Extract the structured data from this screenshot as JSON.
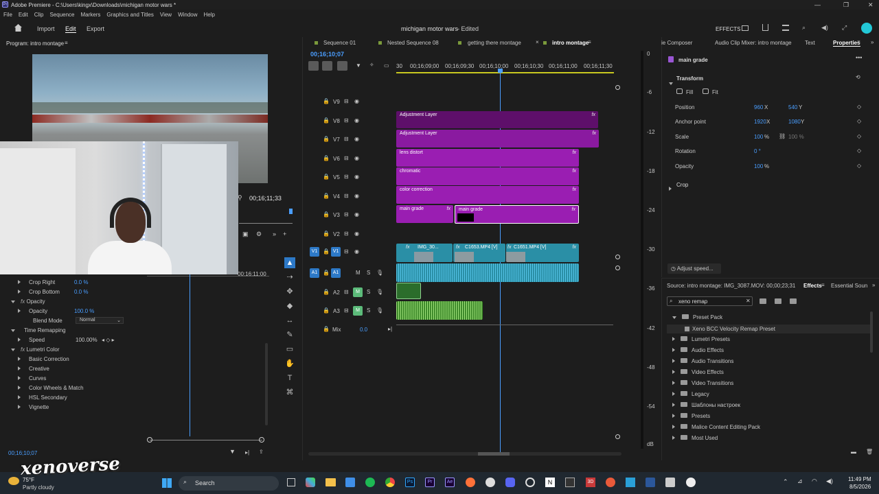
{
  "window": {
    "title": "Adobe Premiere - C:\\Users\\kingx\\Downloads\\michigan motor wars *",
    "minimize": "—",
    "maximize": "❐",
    "close": "✕"
  },
  "menu": [
    "File",
    "Edit",
    "Clip",
    "Sequence",
    "Markers",
    "Graphics and Titles",
    "View",
    "Window",
    "Help"
  ],
  "header": {
    "import": "Import",
    "edit": "Edit",
    "export": "Export",
    "project": "michigan motor wars",
    "status": "- Edited",
    "effects": "EFFECTS"
  },
  "program": {
    "title": "Program: intro montage",
    "timecode": "00;16;11;33",
    "ruler_time": "00;16;11;00"
  },
  "effect_controls": {
    "rows": [
      {
        "label": "Crop Right",
        "value": "0.0 %"
      },
      {
        "label": "Crop Bottom",
        "value": "0.0 %"
      },
      {
        "label": "Opacity",
        "value": ""
      },
      {
        "label": "Opacity",
        "value": "100.0 %"
      },
      {
        "label": "Blend Mode",
        "value": "Normal"
      },
      {
        "label": "Time Remapping",
        "value": ""
      },
      {
        "label": "Speed",
        "value": "100.00%"
      },
      {
        "label": "Lumetri Color",
        "value": ""
      },
      {
        "label": "Basic Correction",
        "value": ""
      },
      {
        "label": "Creative",
        "value": ""
      },
      {
        "label": "Curves",
        "value": ""
      },
      {
        "label": "Color Wheels & Match",
        "value": ""
      },
      {
        "label": "HSL Secondary",
        "value": ""
      },
      {
        "label": "Vignette",
        "value": ""
      }
    ],
    "timecode": "00;16;10;07"
  },
  "timeline": {
    "tabs": [
      "Sequence 01",
      "Nested Sequence 08",
      "getting there montage",
      "intro montage"
    ],
    "timecode": "00;16;10;07",
    "ruler": [
      "30",
      "00;16;09;00",
      "00;16;09;30",
      "00;16;10;00",
      "00;16;10;30",
      "00;16;11;00",
      "00;16;11;30"
    ],
    "video_tracks": [
      "V9",
      "V8",
      "V7",
      "V6",
      "V5",
      "V4",
      "V3",
      "V2",
      "V1"
    ],
    "audio_tracks": [
      "A1",
      "A2",
      "A3"
    ],
    "mix_label": "Mix",
    "mix_value": "0.0",
    "clips": {
      "adj1": "Adjustment Layer",
      "adj2": "Adjustment Layer",
      "lens": "lens distort",
      "chrom": "chromatic",
      "cc": "color correction",
      "mg1": "main grade",
      "mg2": "main grade",
      "img": "IMG_30...",
      "c1": "C1653.MP4 [V]",
      "c2": "C1651.MP4 [V]"
    },
    "meter_labels": [
      "0",
      "-6",
      "-12",
      "-18",
      "-24",
      "-30",
      "-36",
      "-42",
      "-48",
      "-54",
      "dB"
    ]
  },
  "properties": {
    "tabs": [
      "ie Composer",
      "Audio Clip Mixer: intro montage",
      "Text",
      "Properties"
    ],
    "clip_name": "main grade",
    "section": "Transform",
    "fill": "Fill",
    "fit": "Fit",
    "position": {
      "label": "Position",
      "x": "960",
      "y": "540"
    },
    "anchor": {
      "label": "Anchor point",
      "x": "1920",
      "y": "1080"
    },
    "scale": {
      "label": "Scale",
      "v": "100",
      "v2": "100 %"
    },
    "rotation": {
      "label": "Rotation",
      "v": "0 °"
    },
    "opacity": {
      "label": "Opacity",
      "v": "100"
    },
    "crop": "Crop",
    "adjust_speed": "Adjust speed..."
  },
  "effects_panel": {
    "source": "Source: intro montage: IMG_3087.MOV: 00;00;23;31",
    "tab": "Effects",
    "tab2": "Essential Soun",
    "search": "xeno remap",
    "items": [
      {
        "label": "Preset Pack",
        "open": true,
        "indent": 0
      },
      {
        "label": "Xeno BCC Velocity Remap Preset",
        "open": false,
        "indent": 1
      },
      {
        "label": "Lumetri Presets",
        "open": false,
        "indent": 0
      },
      {
        "label": "Audio Effects",
        "open": false,
        "indent": 0
      },
      {
        "label": "Audio Transitions",
        "open": false,
        "indent": 0
      },
      {
        "label": "Video Effects",
        "open": false,
        "indent": 0
      },
      {
        "label": "Video Transitions",
        "open": false,
        "indent": 0
      },
      {
        "label": "Legacy",
        "open": false,
        "indent": 0
      },
      {
        "label": "Шаблоны настроек",
        "open": false,
        "indent": 0
      },
      {
        "label": "Presets",
        "open": false,
        "indent": 0
      },
      {
        "label": "Malice Content Editing Pack",
        "open": false,
        "indent": 0
      },
      {
        "label": "Most Used",
        "open": false,
        "indent": 0
      }
    ]
  },
  "taskbar": {
    "weather_temp": "75°F",
    "weather_text": "Partly cloudy",
    "search": "Search",
    "time": "11:49 PM",
    "date": "8/5/2026"
  },
  "overlay": {
    "watermark": "xenoverse"
  }
}
